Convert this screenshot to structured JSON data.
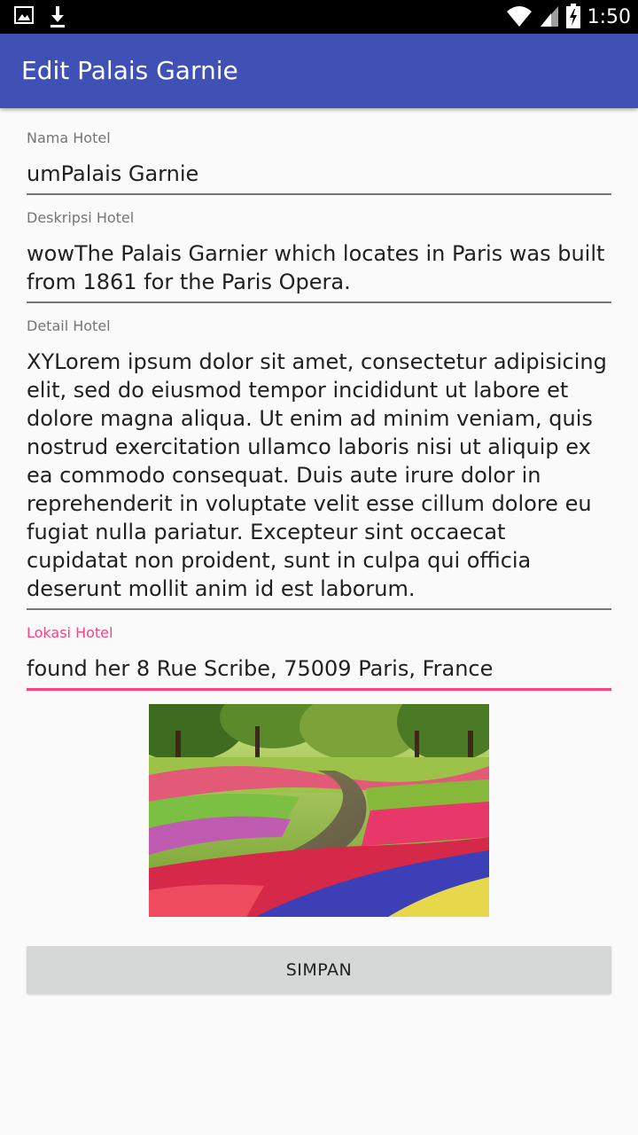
{
  "status_bar": {
    "time": "1:50",
    "icons": [
      "image-icon",
      "download-icon",
      "wifi-icon",
      "signal-icon",
      "battery-icon"
    ]
  },
  "app_bar": {
    "title": "Edit Palais Garnie",
    "color": "#3f51b5"
  },
  "form": {
    "nama_hotel": {
      "label": "Nama Hotel",
      "value": "umPalais Garnie"
    },
    "deskripsi_hotel": {
      "label": "Deskripsi Hotel",
      "value": "wowThe Palais Garnier which locates in Paris was built from 1861 for the Paris Opera."
    },
    "detail_hotel": {
      "label": "Detail Hotel",
      "value": "XYLorem ipsum dolor sit amet, consectetur adipisicing elit, sed do eiusmod tempor incididunt ut labore et dolore magna aliqua. Ut enim ad minim veniam, quis nostrud exercitation ullamco laboris nisi ut aliquip ex ea commodo consequat. Duis aute irure dolor in reprehenderit in voluptate velit esse cillum dolore eu fugiat nulla pariatur. Excepteur sint occaecat cupidatat non proident, sunt in culpa qui officia deserunt mollit anim id est laborum."
    },
    "lokasi_hotel": {
      "label": "Lokasi Hotel",
      "value": "found her 8 Rue Scribe, 75009 Paris, France",
      "accent": "#ff4081"
    }
  },
  "save_button": {
    "label": "SIMPAN"
  }
}
